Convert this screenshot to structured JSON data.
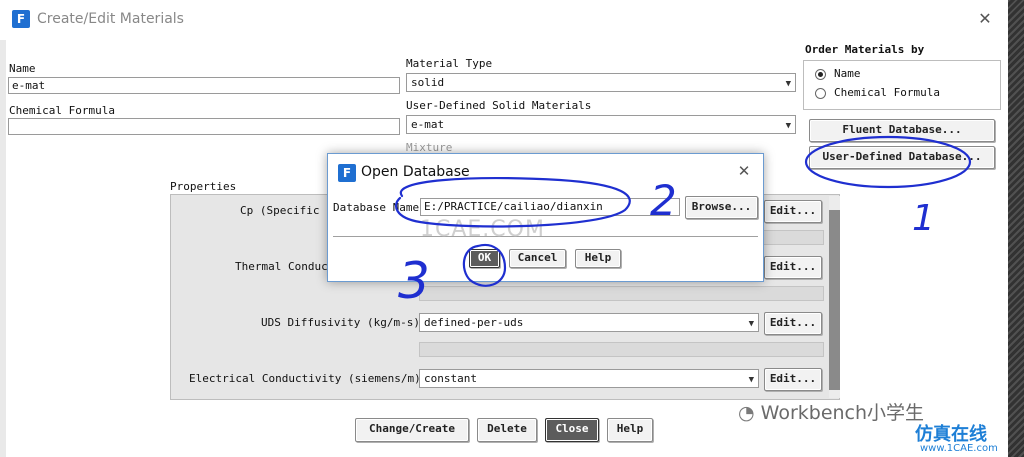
{
  "main_window": {
    "app_icon": "F",
    "title": "Create/Edit Materials",
    "close_glyph": "✕"
  },
  "form": {
    "name_label": "Name",
    "name_value": "e-mat",
    "formula_label": "Chemical Formula",
    "formula_value": "",
    "material_type_label": "Material Type",
    "material_type_value": "solid",
    "user_defined_label": "User-Defined Solid Materials",
    "user_defined_value": "e-mat",
    "mixture_label": "Mixture"
  },
  "order": {
    "label": "Order Materials by",
    "options": [
      "Name",
      "Chemical Formula"
    ],
    "selected": "Name"
  },
  "db_buttons": {
    "fluent": "Fluent Database...",
    "user_defined": "User-Defined Database..."
  },
  "properties": {
    "label": "Properties",
    "rows": [
      {
        "label": "Cp (Specific ",
        "value": "",
        "edit": "Edit..."
      },
      {
        "label": "Thermal Conduc",
        "value": "",
        "edit": "Edit..."
      },
      {
        "label": "UDS Diffusivity (kg/m-s)",
        "value": "defined-per-uds",
        "edit": "Edit..."
      },
      {
        "label": "Electrical Conductivity (siemens/m)",
        "value": "constant",
        "edit": "Edit..."
      }
    ]
  },
  "bottom_buttons": {
    "change_create": "Change/Create",
    "delete": "Delete",
    "close": "Close",
    "help": "Help"
  },
  "dialog": {
    "app_icon": "F",
    "title": "Open Database",
    "close_glyph": "✕",
    "db_name_label": "Database Name",
    "db_name_value": "E:/PRACTICE/cailiao/dianxin",
    "browse": "Browse...",
    "ok": "OK",
    "cancel": "Cancel",
    "help": "Help"
  },
  "annotations": {
    "one": "1",
    "two": "2",
    "three": "3"
  },
  "watermarks": {
    "center": "1CAE.COM",
    "wechat": "Workbench小学生",
    "site_cn": "仿真在线",
    "site_url": "www.1CAE.com"
  },
  "colors": {
    "annotation_ink": "#1f2fd0",
    "accent_blue": "#1f6fd1",
    "ok_button": "#5c5c5c"
  }
}
